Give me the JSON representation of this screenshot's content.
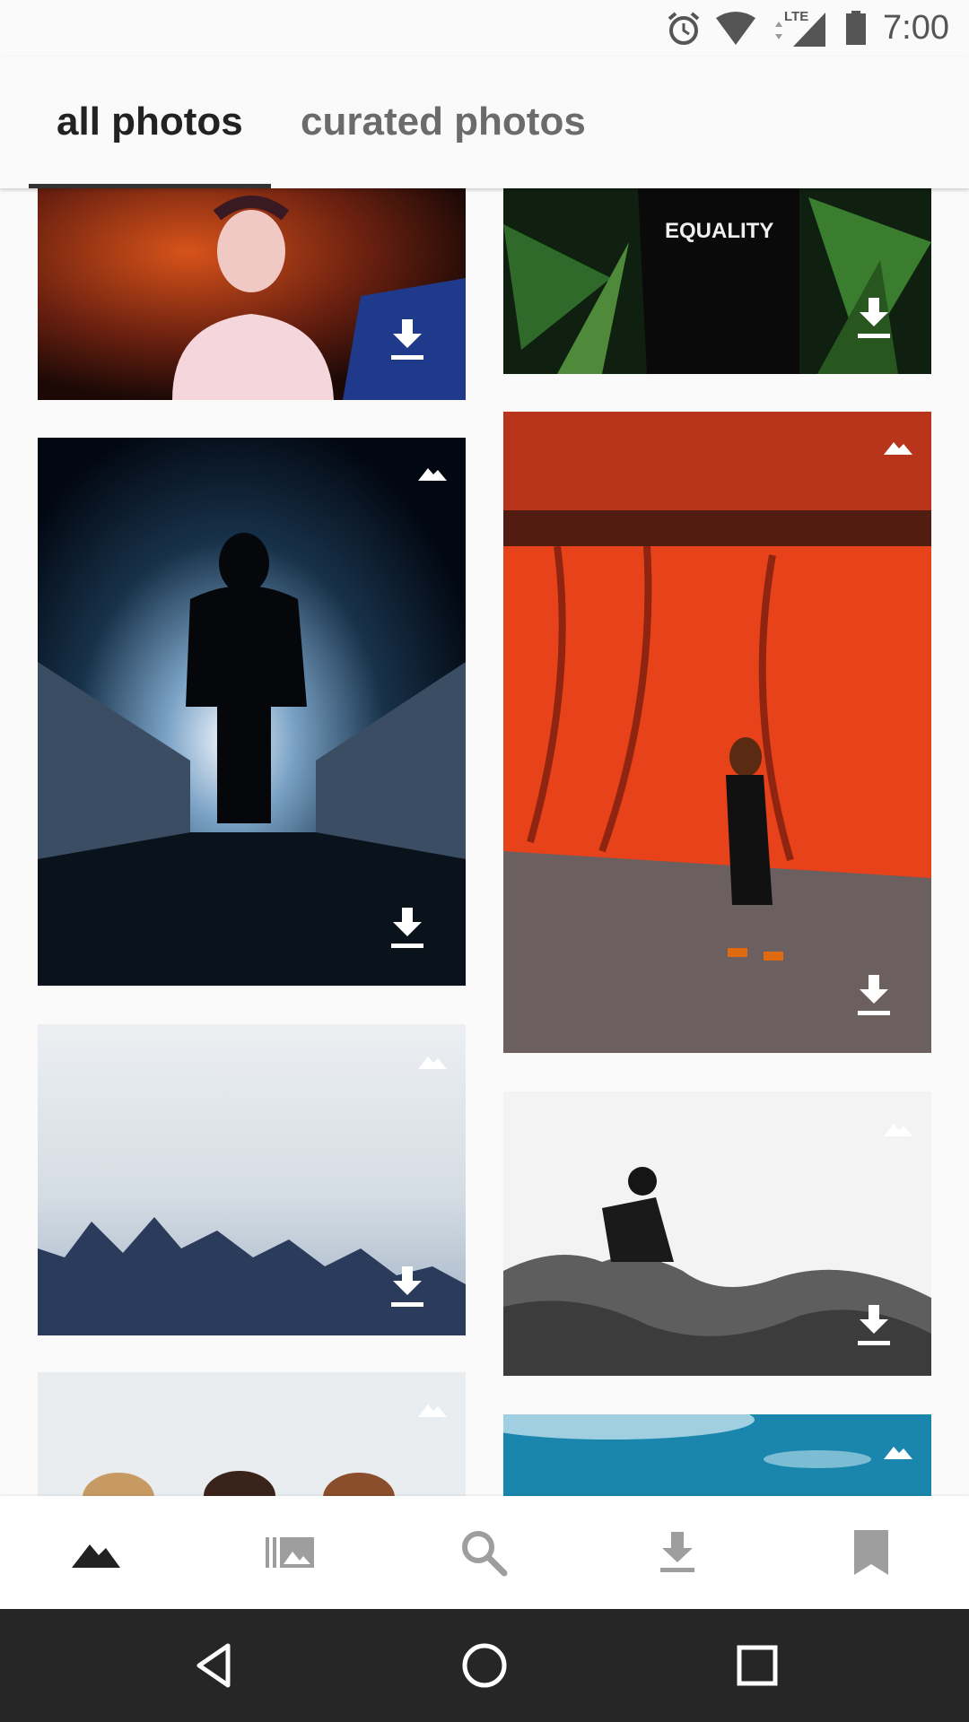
{
  "status_bar": {
    "time": "7:00",
    "network": "LTE",
    "icons": [
      "alarm-icon",
      "wifi-icon",
      "signal-icon",
      "battery-icon"
    ]
  },
  "tabs": [
    {
      "label": "all photos",
      "selected": true
    },
    {
      "label": "curated photos",
      "selected": false
    }
  ],
  "photos": [
    {
      "id": "p1",
      "alt": "woman with flower crown",
      "colors": [
        "#2a0f0a",
        "#d8531a",
        "#f2cfd6"
      ]
    },
    {
      "id": "p2",
      "alt": "person in EQUALITY shirt among bamboo",
      "caption": "EQUALITY",
      "colors": [
        "#0d1a0d",
        "#2f6a2a",
        "#111"
      ]
    },
    {
      "id": "p3",
      "alt": "silhouette floating in tunnel",
      "colors": [
        "#020812",
        "#18324a",
        "#f4f8ff"
      ]
    },
    {
      "id": "p4",
      "alt": "woman walking by orange wall",
      "colors": [
        "#c83814",
        "#f14a1c",
        "#6b5f5f"
      ]
    },
    {
      "id": "p5",
      "alt": "textured blue wall",
      "colors": [
        "#eaedf0",
        "#c9d3dc",
        "#23324f"
      ]
    },
    {
      "id": "p6",
      "alt": "photographer on rocks",
      "colors": [
        "#f7f7f7",
        "#bdbdbd",
        "#4a4a4a"
      ]
    },
    {
      "id": "p7",
      "alt": "three hats on wall",
      "colors": [
        "#e9edf0",
        "#c79a63",
        "#3a231b"
      ]
    },
    {
      "id": "p8",
      "alt": "blue sky",
      "colors": [
        "#1a86ad",
        "#3aa0c3",
        "#d8eef5"
      ]
    }
  ],
  "bottom_nav": [
    {
      "name": "nav-home",
      "icon": "mountains-icon",
      "active": true
    },
    {
      "name": "nav-collections",
      "icon": "collections-icon",
      "active": false
    },
    {
      "name": "nav-search",
      "icon": "search-icon",
      "active": false
    },
    {
      "name": "nav-downloads",
      "icon": "download-icon",
      "active": false
    },
    {
      "name": "nav-bookmarks",
      "icon": "bookmark-icon",
      "active": false
    }
  ],
  "system_nav": [
    "back-icon",
    "home-icon",
    "recents-icon"
  ],
  "colors": {
    "background": "#fafafa",
    "tab_active": "#222222",
    "tab_inactive": "#6b6b6b",
    "nav_active": "#222222",
    "nav_inactive": "#9e9e9e",
    "system_nav_bg": "#262626"
  }
}
